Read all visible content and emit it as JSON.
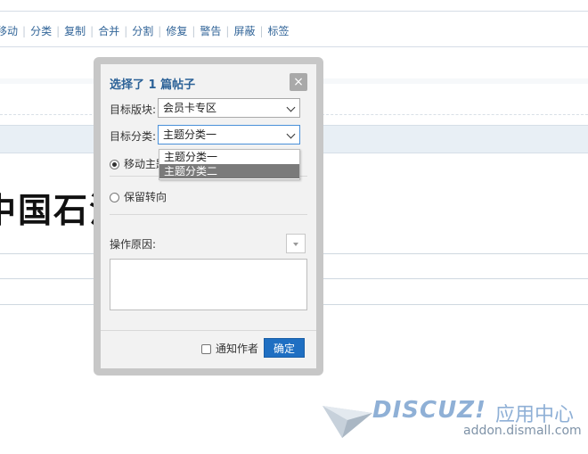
{
  "toolbar": {
    "items": [
      "移动",
      "分类",
      "复制",
      "合并",
      "分割",
      "修复",
      "警告",
      "屏蔽",
      "标签"
    ]
  },
  "background": {
    "thread_title": "中国石油"
  },
  "modal": {
    "title": "选择了 1 篇帖子",
    "close_label": "×",
    "target_forum_label": "目标版块:",
    "target_forum_value": "会员卡专区",
    "target_category_label": "目标分类:",
    "target_category_value": "主题分类一",
    "category_options": [
      "主题分类一",
      "主题分类二"
    ],
    "highlighted_option_index": 1,
    "radio_move_label": "移动主题",
    "radio_keep_label": "保留转向",
    "reason_label": "操作原因:",
    "notify_label": "通知作者",
    "confirm_label": "确定"
  },
  "watermark": {
    "brand": "DISCUZ!",
    "suffix": "应用中心",
    "url": "addon.dismall.com"
  },
  "colors": {
    "accent": "#1f6fc2",
    "title": "#2b6197",
    "link": "#336699"
  }
}
